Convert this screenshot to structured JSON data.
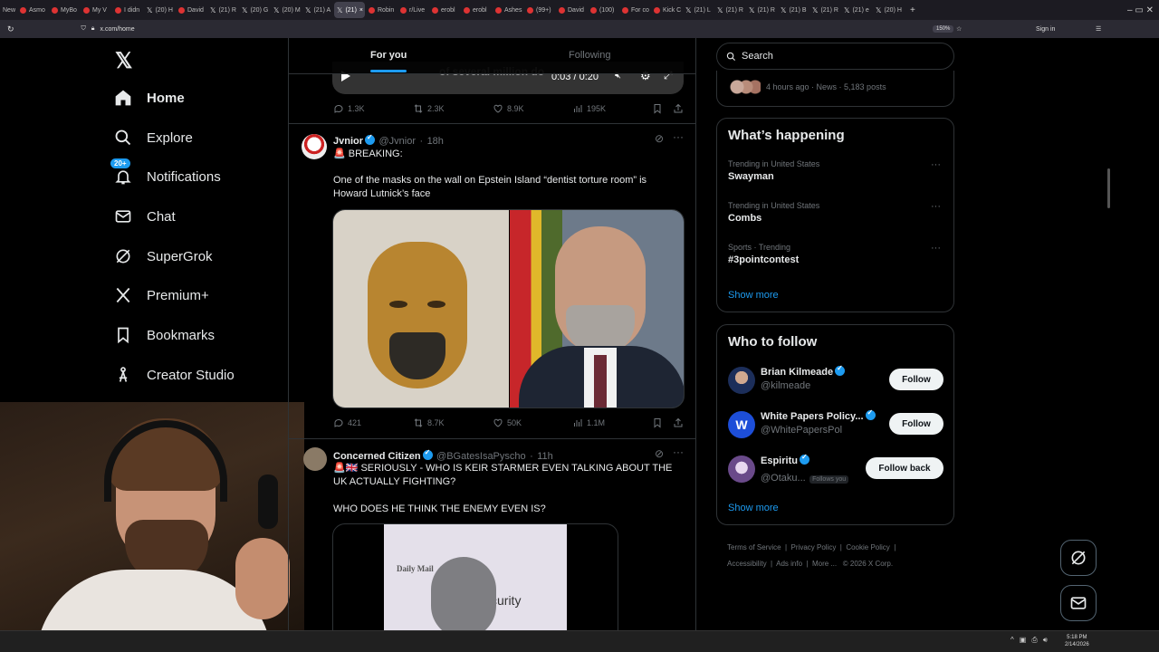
{
  "browser": {
    "tabs": [
      "Asmo",
      "MyBo",
      "My V",
      "I didn",
      "(20) H",
      "David",
      "(21) R",
      "(20) G",
      "(20) M",
      "(21) A",
      "(21)",
      "Robin",
      "r/Live",
      "erobl",
      "erobl",
      "Ashes",
      "(99+)",
      "David",
      "(100)",
      "For co",
      "Kick C",
      "(21) L",
      "(21) R",
      "(21) R",
      "(21) B",
      "(21) R",
      "(21) e",
      "(20) H"
    ],
    "url": "x.com/home",
    "zoom": "150%",
    "sign_in": "Sign in"
  },
  "nav": {
    "home": "Home",
    "explore": "Explore",
    "notifications": "Notifications",
    "notifications_badge": "20+",
    "chat": "Chat",
    "supergrok": "SuperGrok",
    "premium": "Premium+",
    "bookmarks": "Bookmarks",
    "creator_studio": "Creator Studio"
  },
  "feed": {
    "tab_for_you": "For you",
    "tab_following": "Following",
    "video": {
      "time": "0:03 / 0:20",
      "caption": "of several million do"
    },
    "post0": {
      "replies": "1.3K",
      "reposts": "2.3K",
      "likes": "8.9K",
      "views": "195K"
    },
    "post1": {
      "name": "Jvnior",
      "handle": "@Jvnior",
      "time": "18h",
      "line1": "🚨 BREAKING:",
      "text": "One of the masks on the wall on Epstein Island “dentist torture room” is Howard Lutnick’s face",
      "replies": "421",
      "reposts": "8.7K",
      "likes": "50K",
      "views": "1.1M"
    },
    "post2": {
      "name": "Concerned Citizen",
      "handle": "@BGatesIsaPyscho",
      "time": "11h",
      "text": "🚨🇬🇧 SERIOUSLY - WHO IS KEIR STARMER EVEN TALKING ABOUT THE UK ACTUALLY FIGHTING?",
      "text2": "WHO DOES HE THINK THE ENEMY EVEN IS?",
      "image_logo": "Daily Mail",
      "image_text": "curity"
    }
  },
  "right": {
    "search_placeholder": "Search",
    "news_meta": "4 hours ago · News · 5,183 posts",
    "whats_happening": "What’s happening",
    "trends": [
      {
        "meta": "Trending in United States",
        "name": "Swayman"
      },
      {
        "meta": "Trending in United States",
        "name": "Combs"
      },
      {
        "meta": "Sports · Trending",
        "name": "#3pointcontest"
      }
    ],
    "show_more": "Show more",
    "who_to_follow": "Who to follow",
    "follow": [
      {
        "name": "Brian Kilmeade",
        "handle": "@kilmeade",
        "button": "Follow"
      },
      {
        "name": "White Papers Policy...",
        "handle": "@WhitePapersPol",
        "button": "Follow"
      },
      {
        "name": "Espiritu",
        "handle": "@Otaku...",
        "follows_you": "Follows you",
        "button": "Follow back"
      }
    ],
    "show_more2": "Show more",
    "footer": {
      "terms": "Terms of Service",
      "privacy": "Privacy Policy",
      "cookie": "Cookie Policy",
      "accessibility": "Accessibility",
      "ads": "Ads info",
      "more": "More ...",
      "copyright": "© 2026 X Corp."
    }
  },
  "taskbar": {
    "time": "5:18 PM",
    "date": "2/14/2026"
  },
  "colors": {
    "accent": "#1d9bf0",
    "border": "#2f3336",
    "muted": "#71767b",
    "text": "#e7e9ea"
  }
}
